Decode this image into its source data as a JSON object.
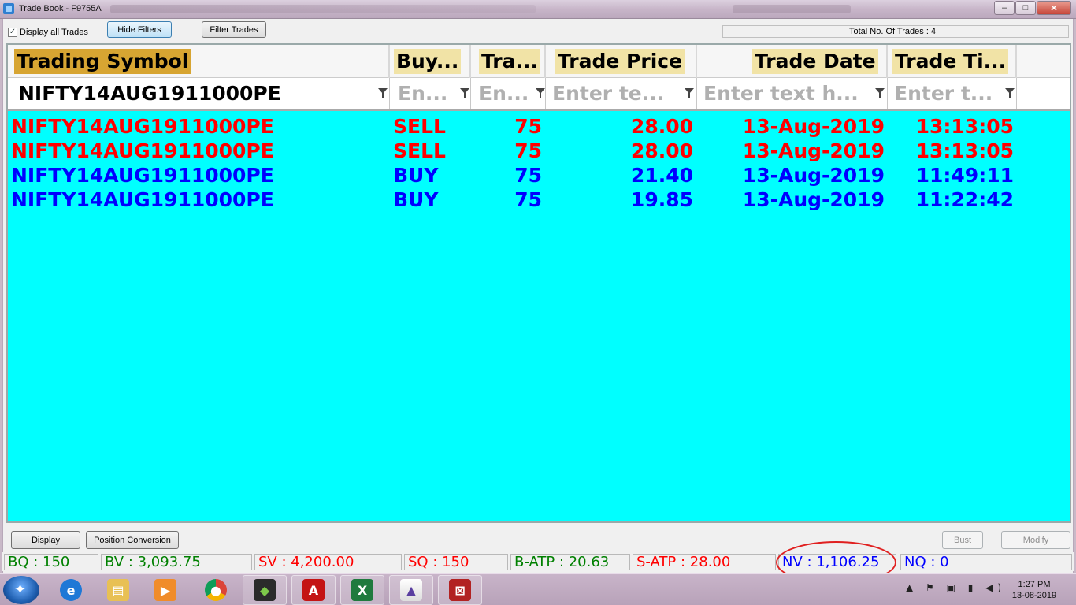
{
  "window": {
    "title": "Trade Book - F9755A",
    "controls": {
      "minimize": "–",
      "maximize": "□",
      "close": "✕"
    }
  },
  "toolbar": {
    "display_all_label": "Display all Trades",
    "display_all_checked": "✓",
    "hide_filters_label": "Hide Filters",
    "filter_trades_label": "Filter Trades",
    "total_trades_text": "Total No. Of Trades : 4"
  },
  "grid": {
    "headers": [
      "Trading Symbol",
      "Buy...",
      "Tra...",
      "Trade Price",
      "Trade Date",
      "Trade Ti..."
    ],
    "filters": {
      "symbol_value": "NIFTY14AUG1911000PE",
      "buy_placeholder": "En...",
      "tra_placeholder": "En...",
      "price_placeholder": "Enter te...",
      "date_placeholder": "Enter text h...",
      "time_placeholder": "Enter t..."
    },
    "rows": [
      {
        "symbol": "NIFTY14AUG1911000PE",
        "side": "SELL",
        "qty": "75",
        "price": "28.00",
        "date": "13-Aug-2019",
        "time": "13:13:05",
        "color": "#ff0000"
      },
      {
        "symbol": "NIFTY14AUG1911000PE",
        "side": "SELL",
        "qty": "75",
        "price": "28.00",
        "date": "13-Aug-2019",
        "time": "13:13:05",
        "color": "#ff0000"
      },
      {
        "symbol": "NIFTY14AUG1911000PE",
        "side": "BUY",
        "qty": "75",
        "price": "21.40",
        "date": "13-Aug-2019",
        "time": "11:49:11",
        "color": "#0000ff"
      },
      {
        "symbol": "NIFTY14AUG1911000PE",
        "side": "BUY",
        "qty": "75",
        "price": "19.85",
        "date": "13-Aug-2019",
        "time": "11:22:42",
        "color": "#0000ff"
      }
    ]
  },
  "actions": {
    "display_label": "Display",
    "position_conversion_label": "Position Conversion",
    "bust_label": "Bust",
    "modify_label": "Modify"
  },
  "status": {
    "bq": "BQ : 150",
    "bv": "BV : 3,093.75",
    "sv": "SV : 4,200.00",
    "sq": "SQ : 150",
    "batp": "B-ATP : 20.63",
    "satp": "S-ATP : 28.00",
    "nv": "NV : 1,106.25",
    "nq": "NQ : 0"
  },
  "taskbar": {
    "tray_icons": "▲ ⚑ ▣ ▮ ◀)",
    "time": "1:27 PM",
    "date": "13-08-2019"
  }
}
